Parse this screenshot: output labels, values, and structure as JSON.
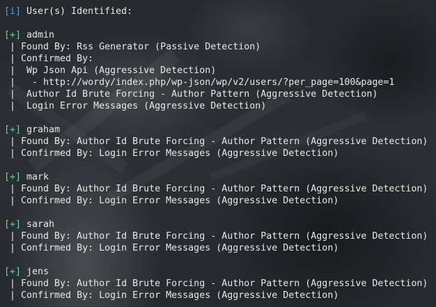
{
  "header": {
    "tag": "[i]",
    "text": " User(s) Identified:"
  },
  "users": [
    {
      "tag": "[+]",
      "name": " admin",
      "details": [
        " | Found By: Rss Generator (Passive Detection)",
        " | Confirmed By:",
        " |  Wp Json Api (Aggressive Detection)",
        " |   - http://wordy/index.php/wp-json/wp/v2/users/?per_page=100&page=1",
        " |  Author Id Brute Forcing - Author Pattern (Aggressive Detection)",
        " |  Login Error Messages (Aggressive Detection)"
      ]
    },
    {
      "tag": "[+]",
      "name": " graham",
      "details": [
        " | Found By: Author Id Brute Forcing - Author Pattern (Aggressive Detection)",
        " | Confirmed By: Login Error Messages (Aggressive Detection)"
      ]
    },
    {
      "tag": "[+]",
      "name": " mark",
      "details": [
        " | Found By: Author Id Brute Forcing - Author Pattern (Aggressive Detection)",
        " | Confirmed By: Login Error Messages (Aggressive Detection)"
      ]
    },
    {
      "tag": "[+]",
      "name": " sarah",
      "details": [
        " | Found By: Author Id Brute Forcing - Author Pattern (Aggressive Detection)",
        " | Confirmed By: Login Error Messages (Aggressive Detection)"
      ]
    },
    {
      "tag": "[+]",
      "name": " jens",
      "details": [
        " | Found By: Author Id Brute Forcing - Author Pattern (Aggressive Detection)",
        " | Confirmed By: Login Error Messages (Aggressive Detection)"
      ]
    }
  ],
  "colors": {
    "info_tag": "#4fa3f7",
    "plus_tag": "#5fd7a0",
    "text": "#e6e8ea"
  }
}
